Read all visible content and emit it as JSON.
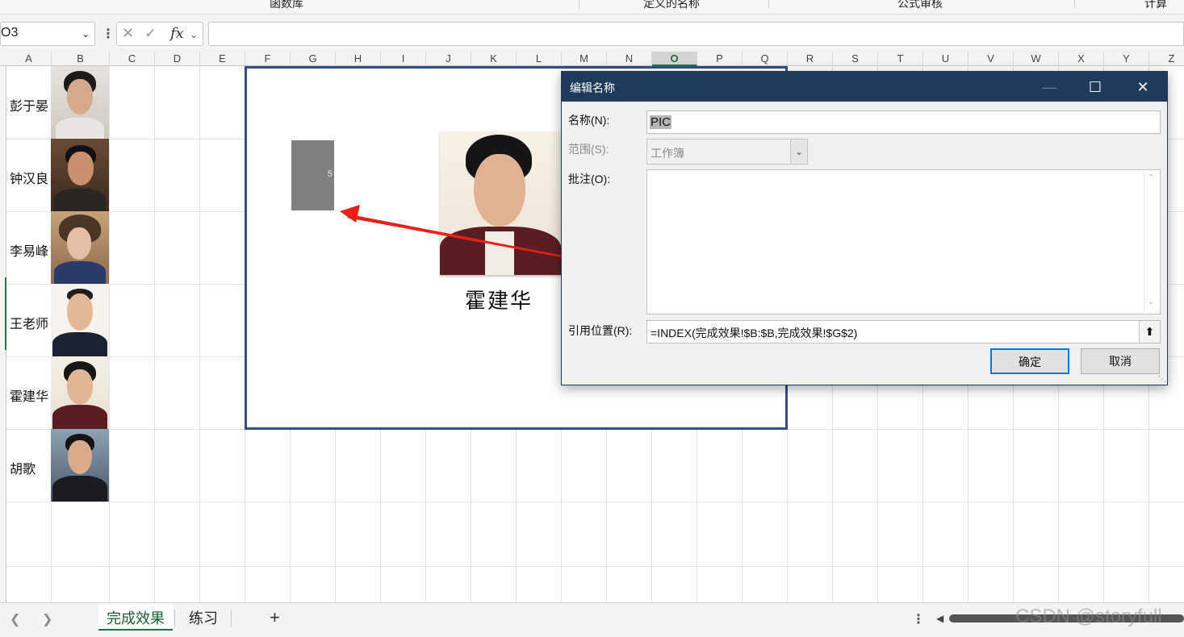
{
  "ribbon": {
    "group_labels": [
      "函数库",
      "定义的名称",
      "公式审核",
      "计算"
    ]
  },
  "formula_bar": {
    "name_box": "O3",
    "cancel_icon": "✕",
    "enter_icon": "✓",
    "fx_label": "fx",
    "formula": ""
  },
  "columns": [
    "A",
    "B",
    "C",
    "D",
    "E",
    "F",
    "G",
    "H",
    "I",
    "J",
    "K",
    "L",
    "M",
    "N",
    "O",
    "P",
    "Q",
    "R",
    "S",
    "T",
    "U",
    "V",
    "W",
    "X",
    "Y",
    "Z"
  ],
  "selected_column": "O",
  "rows": [
    {
      "name": "彭于晏"
    },
    {
      "name": "钟汉良"
    },
    {
      "name": "李易峰"
    },
    {
      "name": "王老师"
    },
    {
      "name": "霍建华"
    },
    {
      "name": "胡歌"
    }
  ],
  "display": {
    "index_value": "5",
    "selected_name": "霍建华"
  },
  "dialog": {
    "title": "编辑名称",
    "name_label": "名称(N):",
    "name_value": "PIC",
    "scope_label": "范围(S):",
    "scope_value": "工作簿",
    "comment_label": "批注(O):",
    "comment_value": "",
    "ref_label": "引用位置(R):",
    "ref_value": "=INDEX(完成效果!$B:$B,完成效果!$G$2)",
    "ok_label": "确定",
    "cancel_label": "取消"
  },
  "sheets": {
    "tabs": [
      "完成效果",
      "练习"
    ],
    "active": "完成效果"
  },
  "watermark": "CSDN @storyfull",
  "colors": {
    "excel_green": "#217346",
    "dialog_title_bg": "#1f3b5c",
    "frame_border": "#2f4f86",
    "arrow": "#e8201a"
  }
}
